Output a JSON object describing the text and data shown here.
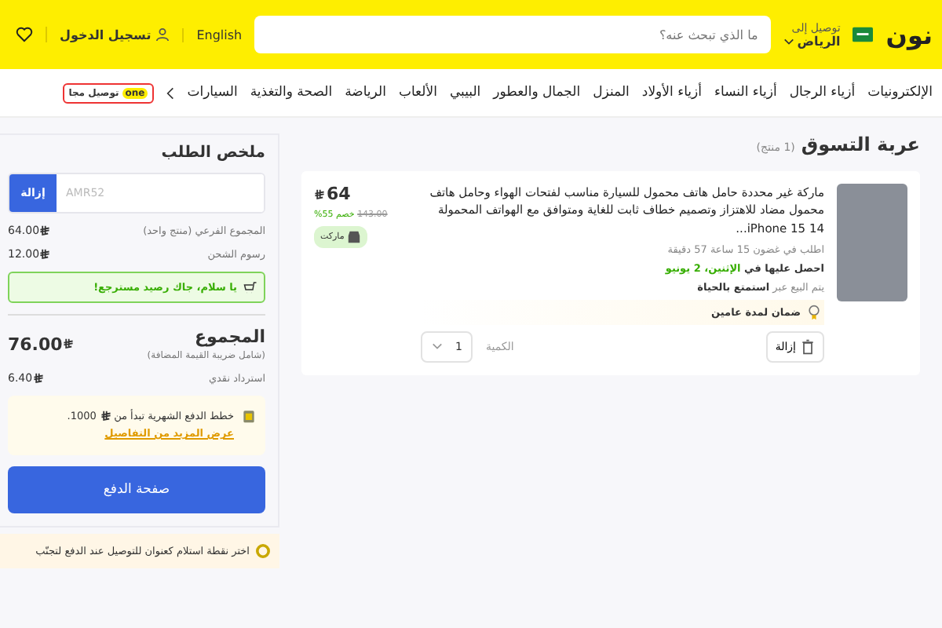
{
  "header": {
    "logo": "نون",
    "deliver_label": "توصيل إلى",
    "deliver_city": "الرياض",
    "search": {
      "placeholder": "ما الذي تبحث عنه؟"
    },
    "language": "English",
    "sign_in": "تسجيل الدخول"
  },
  "nav": {
    "items": [
      "الإلكترونيات",
      "أزياء الرجال",
      "أزياء النساء",
      "أزياء الأولاد",
      "المنزل",
      "الجمال والعطور",
      "البيبي",
      "الألعاب",
      "الرياضة",
      "الصحة والتغذية",
      "السيارات"
    ],
    "promo_logo": "one",
    "promo_text": "توصيل مجا"
  },
  "cart": {
    "title": "عربة التسوق",
    "count": "(1 منتج)",
    "items": [
      {
        "title": "ماركة غير محددة حامل هاتف محمول للسيارة مناسب لفتحات الهواء وحامل هاتف محمول مضاد للاهتزاز وتصميم خطاف ثابت للغاية ومتوافق مع الهواتف المحمولة iPhone 15 14...",
        "price": "64",
        "old_price": "143.00",
        "discount": "خصم 55%",
        "badge": "ماركت",
        "order_within": "اطلب في غضون 15 ساعة 57 دقيقة",
        "delivery_label": "احصل عليها في",
        "delivery_date": "الإثنين، 2 يونيو",
        "seller": "يتم البيع عبر **استمتع بالحياة**",
        "warranty": "ضمان لمدة عامين",
        "remove": "إزالة",
        "quantity_label": "الكمية",
        "quantity": "1"
      }
    ]
  },
  "summary": {
    "title": "ملخص الطلب",
    "coupon": {
      "placeholder": "AMR52",
      "button": "إزالة"
    },
    "rows": [
      {
        "label": "المجموع الفرعي (منتج واحد)",
        "value": "64.00"
      },
      {
        "label": "رسوم الشحن",
        "value": "12.00"
      }
    ],
    "cashback_notice": "يا سلام، جاك رصيد مسترجع!",
    "total_label": "المجموع",
    "total_note": "(شامل ضريبة القيمة المضافة)",
    "total": "76.00",
    "cashback_label": "استرداد نقدي",
    "cashback": "6.40",
    "installments": {
      "text_before": "خطط الدفع الشهرية تبدأ من",
      "amount": "1000.",
      "link": "عرض المزيد من التفاصيل"
    },
    "checkout": "صفحة الدفع"
  },
  "bottom_notice": "اختر نقطة استلام كعنوان للتوصيل عند الدفع لتجنّب"
}
